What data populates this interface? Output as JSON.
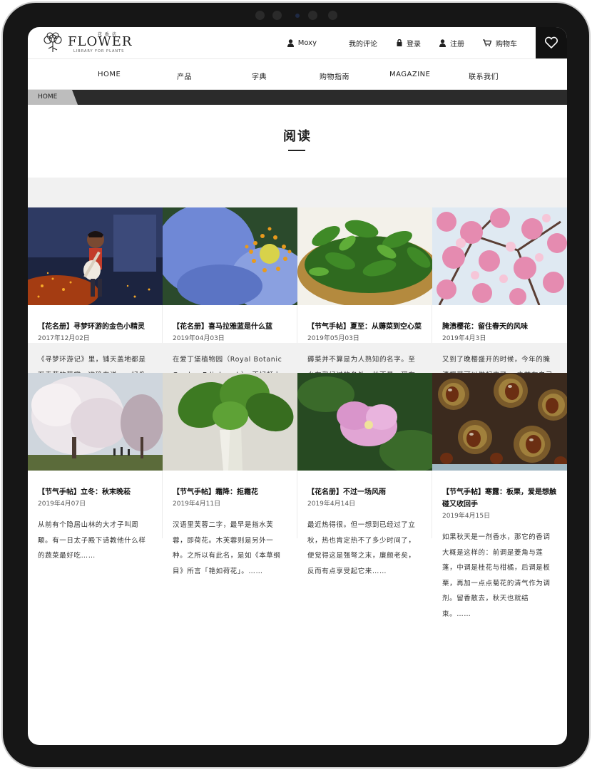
{
  "header": {
    "logo_cn": "花 香 坊",
    "logo_main": "FLOWER",
    "logo_sub": "LIBRARY FOR PLANTS",
    "user": "Moxy",
    "my_comments": "我的评论",
    "login": "登录",
    "register": "注册",
    "cart": "购物车"
  },
  "nav": [
    "HOME",
    "产品",
    "字典",
    "购物指南",
    "MAGAZINE",
    "联系我们"
  ],
  "breadcrumb": {
    "home": "HOME"
  },
  "page_title": "阅读",
  "articles": [
    {
      "title": "【花名册】寻梦环游的金色小精灵",
      "date": "2017年12月02日",
      "desc": "《寻梦环游记》里，铺天盖地都是万寿菊的花瓣。准确来说……好像除了万寿菊，基本没见到别的花朵……",
      "image": "coco-guitar-marigold-petals"
    },
    {
      "title": "【花名册】喜马拉雅蓝是什么蓝",
      "date": "2019年04月03日",
      "desc": "在爱丁堡植物园（Royal Botanic Garden Edinburgh），正好赶上绿绒蒿盛开的季节……",
      "image": "blue-poppy"
    },
    {
      "title": "【节气手帖】夏至：从薅菜到空心菜",
      "date": "2019年05月03日",
      "desc": "薅菜并不算是为人熟知的名字。至少在我经过的各处，并不是。现在非常努力地回想起来，好像在很多年前……",
      "image": "green-leaves-basket"
    },
    {
      "title": "腌渍樱花：留住春天的风味",
      "date": "2019年4月3日",
      "desc": "又到了晚樱盛开的时候，今年的腌渍樱花可以做起来了。 之前在自己的书里画过一个步骤图，但篇幅所限……",
      "image": "cherry-blossom"
    },
    {
      "title": "【节气手帖】立冬：秋末晚菘",
      "date": "2019年4月07日",
      "desc": "从前有个隐居山林的大才子叫周颙。有一日太子殿下请教他什么样的蔬菜最好吃……",
      "image": "white-blossom-tree"
    },
    {
      "title": "【节气手帖】霜降：拒霜花",
      "date": "2019年4月11日",
      "desc": "汉语里芙蓉二字，最早是指水芙蓉，即荷花。木芙蓉则是另外一种。之所以有此名，是如《本草纲目》所言「艳如荷花」。……",
      "image": "bok-choy"
    },
    {
      "title": "【花名册】不过一场风雨",
      "date": "2019年4月14日",
      "desc": "最近热得很。但一想到已经过了立秋，热也肯定热不了多少时间了，便觉得这是强弩之末，廉颇老矣，反而有点享受起它来……",
      "image": "pink-hibiscus"
    },
    {
      "title": "【节气手帖】寒露：板栗，爱是想触碰又收回手",
      "date": "2019年4月15日",
      "desc": "如果秋天是一剂香水，那它的香调大概是这样的：前调是菱角与莲蓬，中调是桂花与柑橘，后调是板栗，再加一点点菊花的清气作为调剂。留香散去，秋天也就结束。……",
      "image": "chestnuts"
    }
  ],
  "colors": {
    "accent": "#111111",
    "breadcrumb_bar": "#2b2b2b",
    "section_gap": "#f1f1f1"
  }
}
